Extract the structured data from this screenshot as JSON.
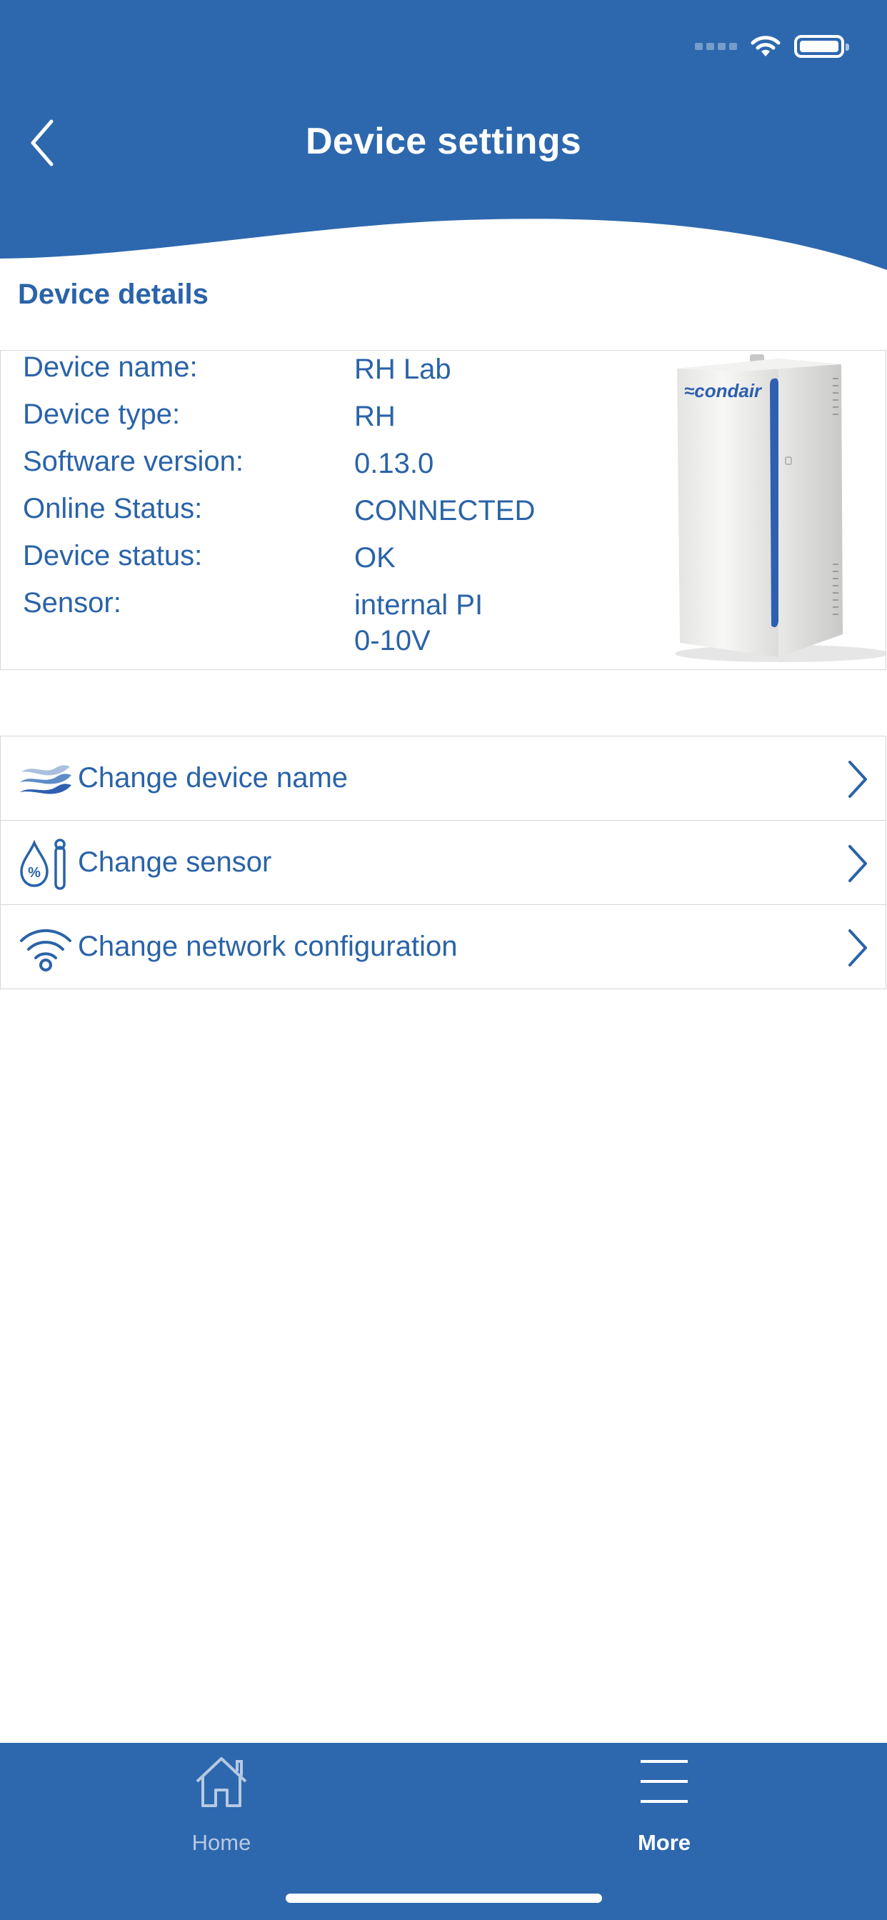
{
  "header": {
    "title": "Device settings",
    "color": "#2d68ae"
  },
  "device_details": {
    "section_title": "Device details",
    "rows": [
      {
        "label": "Device name:",
        "value": "RH Lab"
      },
      {
        "label": "Device type:",
        "value": "RH"
      },
      {
        "label": "Software version:",
        "value": "0.13.0"
      },
      {
        "label": "Online Status:",
        "value": "CONNECTED"
      },
      {
        "label": "Device status:",
        "value": "OK"
      },
      {
        "label": "Sensor:",
        "value": "internal PI",
        "value_line2": "0-10V"
      }
    ],
    "device_brand": "condair"
  },
  "menu": {
    "items": [
      {
        "label": "Change device name",
        "icon": "waves-icon"
      },
      {
        "label": "Change sensor",
        "icon": "humidity-sensor-icon"
      },
      {
        "label": "Change network configuration",
        "icon": "wifi-icon"
      }
    ]
  },
  "tabbar": {
    "home_label": "Home",
    "more_label": "More",
    "active": "More"
  }
}
